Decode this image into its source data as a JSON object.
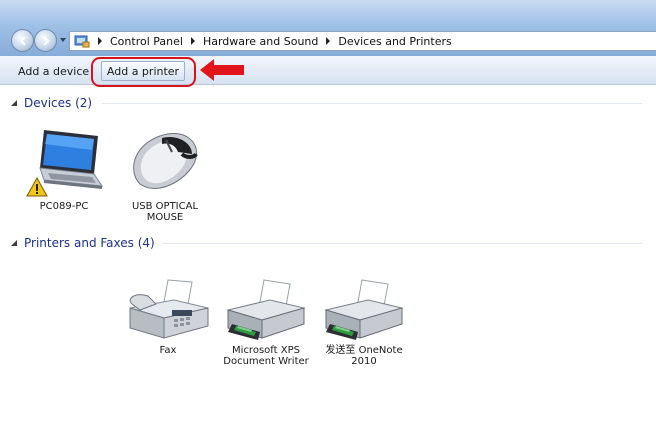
{
  "address_bar": {
    "crumbs": [
      "Control Panel",
      "Hardware and Sound",
      "Devices and Printers"
    ]
  },
  "toolbar": {
    "add_device_label": "Add a device",
    "add_printer_label": "Add a printer"
  },
  "groups": {
    "devices": {
      "title": "Devices (2)",
      "items": [
        {
          "label": "PC089-PC",
          "icon": "laptop-warning-icon"
        },
        {
          "label": "USB OPTICAL\nMOUSE",
          "icon": "mouse-icon"
        }
      ]
    },
    "printers": {
      "title": "Printers and Faxes (4)",
      "items": [
        {
          "label": "Fax",
          "icon": "fax-icon"
        },
        {
          "label": "Microsoft XPS\nDocument Writer",
          "icon": "printer-icon"
        },
        {
          "label": "发送至 OneNote\n2010",
          "icon": "printer-icon"
        }
      ]
    }
  },
  "annotation": {
    "highlight_color": "#d5141b"
  }
}
